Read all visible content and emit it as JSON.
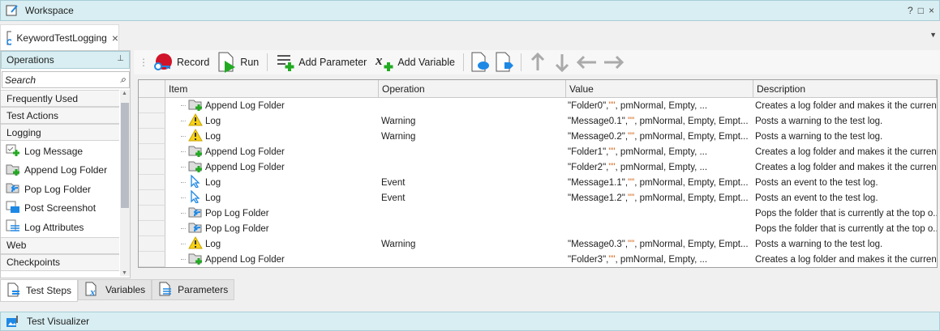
{
  "window": {
    "title": "Workspace",
    "help": "?",
    "maximize": "□",
    "close": "×"
  },
  "doc_tab": {
    "label": "KeywordTestLogging",
    "close": "×"
  },
  "operations": {
    "title": "Operations",
    "search_placeholder": "Search",
    "categories": [
      "Frequently Used",
      "Test Actions",
      "Logging"
    ],
    "logging_items": [
      {
        "label": "Log Message",
        "icon": "log-message-icon"
      },
      {
        "label": "Append Log Folder",
        "icon": "append-folder-icon"
      },
      {
        "label": "Pop Log Folder",
        "icon": "pop-folder-icon"
      },
      {
        "label": "Post Screenshot",
        "icon": "screenshot-icon"
      },
      {
        "label": "Log Attributes",
        "icon": "attributes-icon"
      }
    ],
    "more_categories": [
      "Web",
      "Checkpoints"
    ]
  },
  "toolbar": {
    "record": "Record",
    "run": "Run",
    "add_parameter": "Add Parameter",
    "add_variable": "Add Variable"
  },
  "grid": {
    "columns": [
      "Item",
      "Operation",
      "Value",
      "Description"
    ],
    "rows": [
      {
        "item": "Append Log Folder",
        "icon": "append",
        "op": "",
        "value": "\"Folder0\", \"\", pmNormal, Empty, ...",
        "desc": "Creates a log folder and makes it the curren..."
      },
      {
        "item": "Log",
        "icon": "warning",
        "op": "Warning",
        "value": "\"Message0.1\", \"\", pmNormal, Empty, Empt...",
        "desc": "Posts a warning to the test log."
      },
      {
        "item": "Log",
        "icon": "warning",
        "op": "Warning",
        "value": "\"Message0.2\", \"\", pmNormal, Empty, Empt...",
        "desc": "Posts a warning to the test log."
      },
      {
        "item": "Append Log Folder",
        "icon": "append",
        "op": "",
        "value": "\"Folder1\", \"\", pmNormal, Empty, ...",
        "desc": "Creates a log folder and makes it the curren..."
      },
      {
        "item": "Append Log Folder",
        "icon": "append",
        "op": "",
        "value": "\"Folder2\", \"\", pmNormal, Empty, ...",
        "desc": "Creates a log folder and makes it the curren..."
      },
      {
        "item": "Log",
        "icon": "event",
        "op": "Event",
        "value": "\"Message1.1\", \"\", pmNormal, Empty, Empt...",
        "desc": "Posts an event to the test log."
      },
      {
        "item": "Log",
        "icon": "event",
        "op": "Event",
        "value": "\"Message1.2\", \"\", pmNormal, Empty, Empt...",
        "desc": "Posts an event to the test log."
      },
      {
        "item": "Pop Log Folder",
        "icon": "pop",
        "op": "",
        "value": "",
        "desc": "Pops the folder that is currently at the top o..."
      },
      {
        "item": "Pop Log Folder",
        "icon": "pop",
        "op": "",
        "value": "",
        "desc": "Pops the folder that is currently at the top o..."
      },
      {
        "item": "Log",
        "icon": "warning",
        "op": "Warning",
        "value": "\"Message0.3\", \"\", pmNormal, Empty, Empt...",
        "desc": "Posts a warning to the test log."
      },
      {
        "item": "Append Log Folder",
        "icon": "append",
        "op": "",
        "value": "\"Folder3\", \"\", pmNormal, Empty, ...",
        "desc": "Creates a log folder and makes it the curren..."
      }
    ]
  },
  "bottom_tabs": [
    {
      "label": "Test Steps",
      "active": true
    },
    {
      "label": "Variables"
    },
    {
      "label": "Parameters"
    }
  ],
  "visualizer": {
    "title": "Test Visualizer"
  },
  "colors": {
    "panel_header": "#d8eef2",
    "record": "#d0142a",
    "run": "#22aa22",
    "accent": "#1e88e5"
  }
}
